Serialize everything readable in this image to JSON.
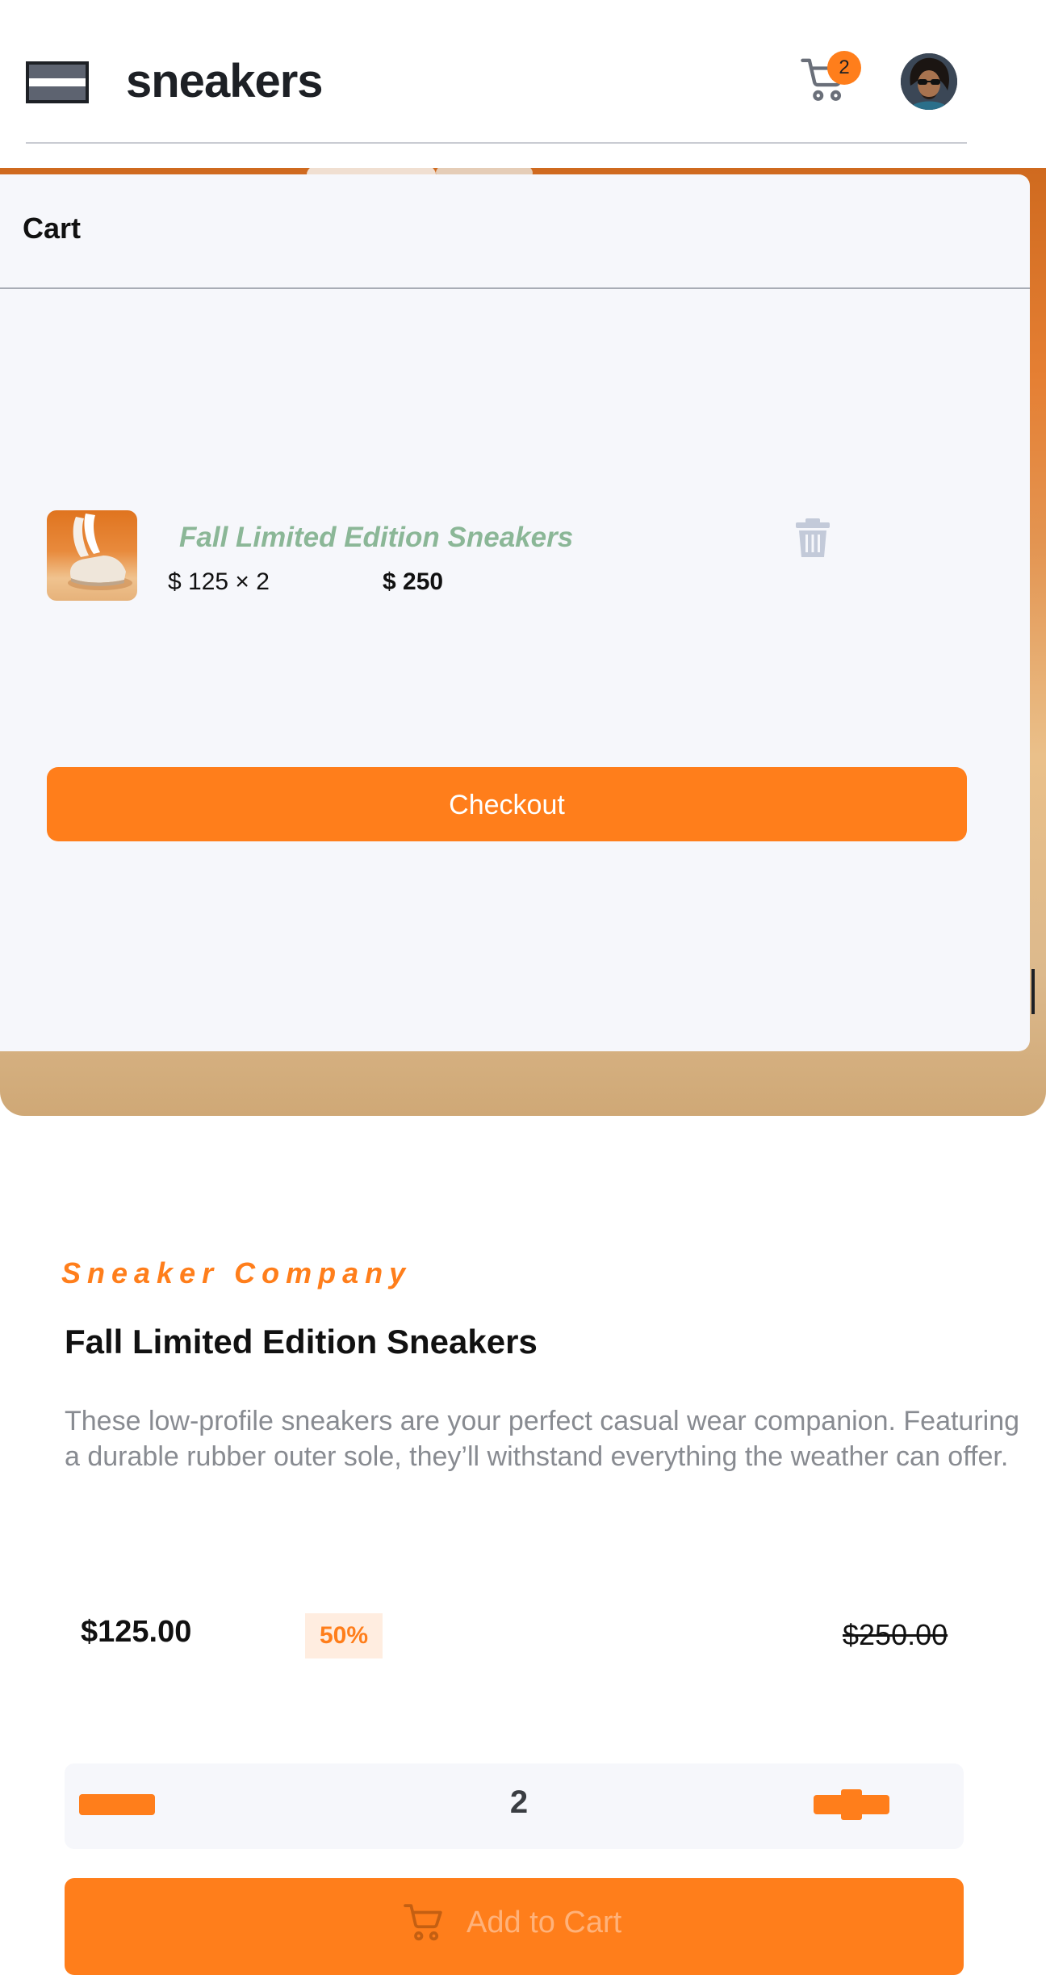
{
  "header": {
    "logo": "sneakers",
    "cart_count": "2"
  },
  "cart": {
    "title": "Cart",
    "item": {
      "name": "Fall Limited Edition Sneakers",
      "calc": "$ 125 × 2",
      "total": "$ 250"
    },
    "checkout_label": "Checkout"
  },
  "product": {
    "company": "Sneaker Company",
    "title": "Fall Limited Edition Sneakers",
    "description": "These low-profile sneakers are your perfect casual wear companion. Featuring a durable rubber outer sole, they’ll withstand everything the weather can offer.",
    "price": "$125.00",
    "discount": "50%",
    "old_price": "$250.00",
    "quantity": "2",
    "add_to_cart_label": "Add to Cart"
  },
  "colors": {
    "accent": "#ff7e1b",
    "accent_light": "#ffede0",
    "text_dark": "#1d2025",
    "text_muted": "#888b91",
    "item_name": "#8bb797",
    "panel_bg": "#f6f7fb"
  },
  "icons": {
    "menu": "menu-icon",
    "cart": "cart-icon",
    "delete": "trash-icon",
    "add_to_cart": "cart-icon"
  }
}
